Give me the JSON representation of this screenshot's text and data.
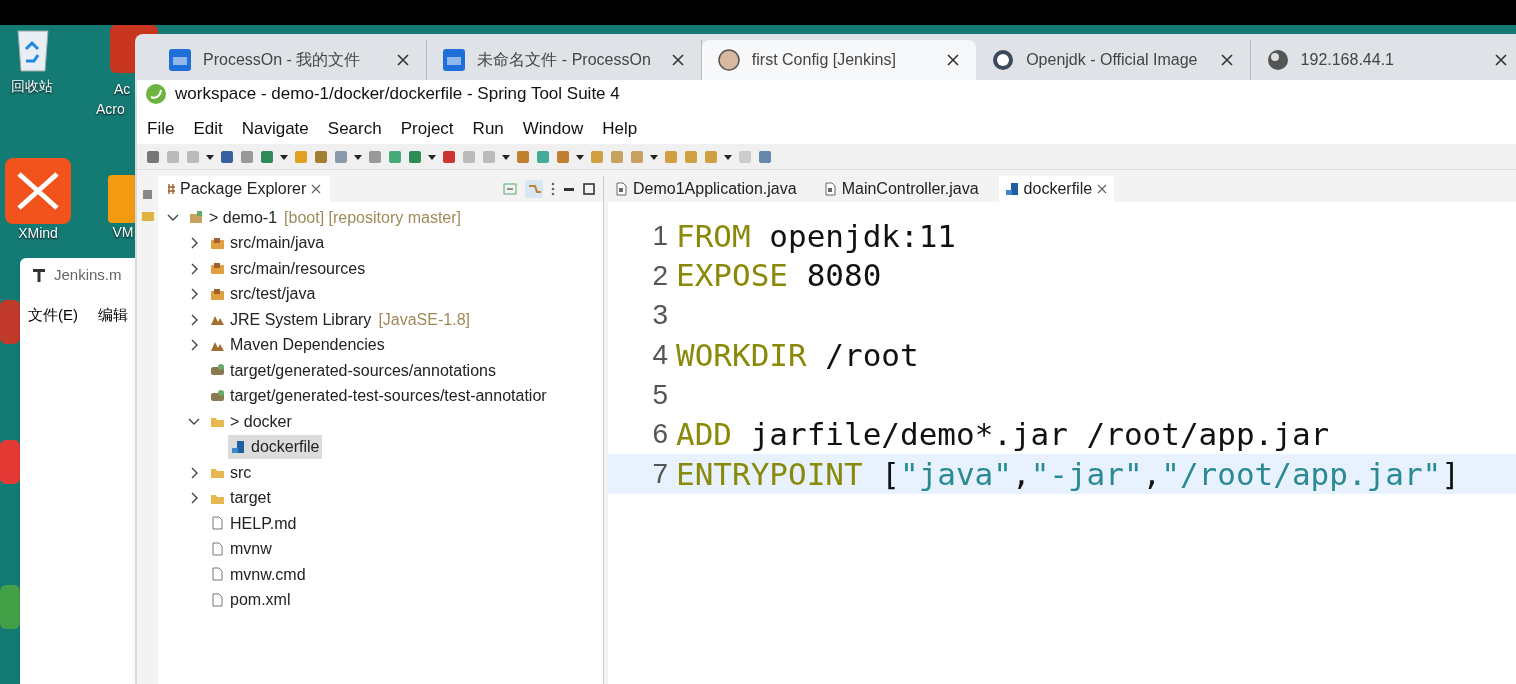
{
  "desktop": {
    "icons": [
      {
        "label": "回收站",
        "kind": "recycle"
      },
      {
        "label": "Ac",
        "sublabel": "Acro",
        "kind": "red"
      },
      {
        "label": "XMind",
        "kind": "xmind"
      },
      {
        "label": "VM",
        "kind": "orange"
      }
    ]
  },
  "notepad": {
    "title": "Jenkins.m",
    "menu": [
      "文件(E)",
      "编辑"
    ]
  },
  "browser": {
    "tabs": [
      {
        "title": "ProcessOn - 我的文件",
        "kind": "on",
        "selected": false
      },
      {
        "title": "未命名文件 - ProcessOn",
        "kind": "on",
        "selected": false
      },
      {
        "title": "first Config [Jenkins]",
        "kind": "jenkins",
        "selected": true
      },
      {
        "title": "Openjdk - Official Image",
        "kind": "docker",
        "selected": false
      },
      {
        "title": "192.168.44.1",
        "kind": "globe",
        "selected": false
      }
    ]
  },
  "window": {
    "title": "workspace - demo-1/docker/dockerfile - Spring Tool Suite 4"
  },
  "menu": [
    "File",
    "Edit",
    "Navigate",
    "Search",
    "Project",
    "Run",
    "Window",
    "Help"
  ],
  "package_explorer": {
    "title": "Package Explorer",
    "tree": [
      {
        "label": "> demo-1",
        "decoration": "[boot] [repository master]",
        "kind": "project",
        "expanded": true,
        "selected": false,
        "children": [
          {
            "label": "src/main/java",
            "kind": "source",
            "expanded": false,
            "selected": false
          },
          {
            "label": "src/main/resources",
            "kind": "source",
            "expanded": false,
            "selected": false
          },
          {
            "label": "src/test/java",
            "kind": "source",
            "expanded": false,
            "selected": false
          },
          {
            "label": "JRE System Library",
            "decoration": "[JavaSE-1.8]",
            "kind": "library",
            "expanded": false,
            "selected": false
          },
          {
            "label": "Maven Dependencies",
            "kind": "library",
            "expanded": false,
            "selected": false
          },
          {
            "label": "target/generated-sources/annotations",
            "kind": "generated",
            "selected": false
          },
          {
            "label": "target/generated-test-sources/test-annotatior",
            "kind": "generated",
            "selected": false
          },
          {
            "label": "> docker",
            "kind": "folder",
            "expanded": true,
            "selected": false,
            "children": [
              {
                "label": "dockerfile",
                "kind": "docker",
                "selected": true
              }
            ]
          },
          {
            "label": "src",
            "kind": "folder",
            "expanded": false,
            "selected": false
          },
          {
            "label": "target",
            "kind": "folder",
            "expanded": false,
            "selected": false
          },
          {
            "label": "HELP.md",
            "kind": "file",
            "selected": false
          },
          {
            "label": "mvnw",
            "kind": "file",
            "selected": false
          },
          {
            "label": "mvnw.cmd",
            "kind": "file",
            "selected": false
          },
          {
            "label": "pom.xml",
            "kind": "file",
            "selected": false
          }
        ]
      }
    ]
  },
  "editor": {
    "tabs": [
      {
        "label": "Demo1Application.java",
        "kind": "java",
        "selected": false
      },
      {
        "label": "MainController.java",
        "kind": "java",
        "selected": false
      },
      {
        "label": "dockerfile",
        "kind": "docker",
        "selected": true
      }
    ],
    "lines": [
      {
        "number": "1",
        "current": false,
        "tokens": [
          {
            "text": "FROM",
            "kind": "keyword"
          },
          {
            "text": " openjdk:11",
            "kind": "plain"
          }
        ]
      },
      {
        "number": "2",
        "current": false,
        "tokens": [
          {
            "text": "EXPOSE",
            "kind": "keyword"
          },
          {
            "text": " 8080",
            "kind": "plain"
          }
        ]
      },
      {
        "number": "3",
        "current": false
      },
      {
        "number": "4",
        "current": false,
        "tokens": [
          {
            "text": "WORKDIR",
            "kind": "keyword"
          },
          {
            "text": " /root",
            "kind": "plain"
          }
        ]
      },
      {
        "number": "5",
        "current": false
      },
      {
        "number": "6",
        "current": false,
        "tokens": [
          {
            "text": "ADD",
            "kind": "keyword"
          },
          {
            "text": " jarfile/demo*.jar /root/app.jar",
            "kind": "plain"
          }
        ]
      },
      {
        "number": "7",
        "current": true,
        "tokens": [
          {
            "text": "ENTRYPOINT",
            "kind": "keyword"
          },
          {
            "text": " [",
            "kind": "plain"
          },
          {
            "text": "\"java\"",
            "kind": "string"
          },
          {
            "text": ",",
            "kind": "plain"
          },
          {
            "text": "\"-jar\"",
            "kind": "string"
          },
          {
            "text": ",",
            "kind": "plain"
          },
          {
            "text": "\"/root/app.jar\"",
            "kind": "string"
          },
          {
            "text": "]",
            "kind": "plain"
          }
        ]
      }
    ]
  }
}
